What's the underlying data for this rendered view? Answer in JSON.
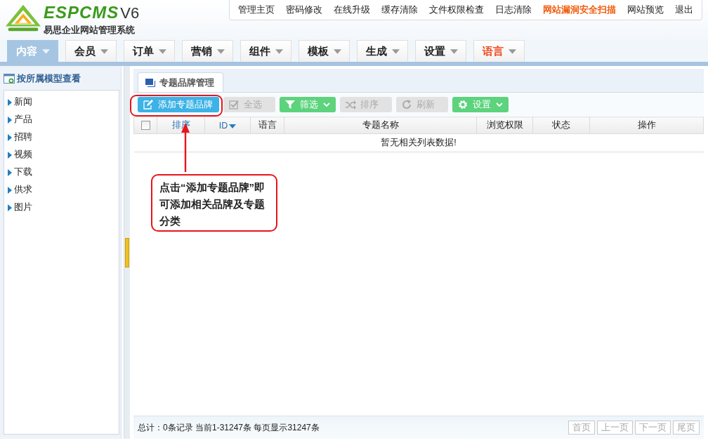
{
  "logo": {
    "brand": "ESPCMS",
    "version": "V6",
    "subtitle": "易思企业网站管理系统"
  },
  "top_links": [
    {
      "label": "管理主页",
      "highlight": false
    },
    {
      "label": "密码修改",
      "highlight": false
    },
    {
      "label": "在线升级",
      "highlight": false
    },
    {
      "label": "缓存清除",
      "highlight": false
    },
    {
      "label": "文件权限检查",
      "highlight": false
    },
    {
      "label": "日志清除",
      "highlight": false
    },
    {
      "label": "网站漏洞安全扫描",
      "highlight": true
    },
    {
      "label": "网站预览",
      "highlight": false
    },
    {
      "label": "退出",
      "highlight": false
    }
  ],
  "nav_tabs": [
    {
      "label": "内容",
      "selected": true,
      "highlight": false
    },
    {
      "label": "会员",
      "selected": false,
      "highlight": false
    },
    {
      "label": "订单",
      "selected": false,
      "highlight": false
    },
    {
      "label": "营销",
      "selected": false,
      "highlight": false
    },
    {
      "label": "组件",
      "selected": false,
      "highlight": false
    },
    {
      "label": "模板",
      "selected": false,
      "highlight": false
    },
    {
      "label": "生成",
      "selected": false,
      "highlight": false
    },
    {
      "label": "设置",
      "selected": false,
      "highlight": false
    },
    {
      "label": "语言",
      "selected": false,
      "highlight": true
    }
  ],
  "sidebar": {
    "title": "按所属模型查看",
    "items": [
      "新闻",
      "产品",
      "招聘",
      "视频",
      "下载",
      "供求",
      "图片"
    ]
  },
  "panel_tab": {
    "label": "专题品牌管理",
    "selected": true
  },
  "toolbar": [
    {
      "label": "添加专题品牌",
      "kind": "primary",
      "caret": false
    },
    {
      "label": "全选",
      "kind": "muted",
      "caret": false
    },
    {
      "label": "筛选",
      "kind": "green",
      "caret": true
    },
    {
      "label": "排序",
      "kind": "muted",
      "caret": false
    },
    {
      "label": "刷新",
      "kind": "muted",
      "caret": false
    },
    {
      "label": "设置",
      "kind": "green",
      "caret": true
    }
  ],
  "table": {
    "select_all": {
      "checked": false
    },
    "columns": [
      {
        "label": "排序",
        "kind": "link"
      },
      {
        "label": "ID",
        "kind": "sort"
      },
      {
        "label": "语言",
        "kind": "plain"
      },
      {
        "label": "专题名称",
        "kind": "plain"
      },
      {
        "label": "浏览权限",
        "kind": "plain"
      },
      {
        "label": "状态",
        "kind": "plain"
      },
      {
        "label": "操作",
        "kind": "plain"
      }
    ],
    "empty_message": "暂无相关列表数据!"
  },
  "annotation": {
    "text": "点击“添加专题品牌”即可添加相关品牌及专题分类"
  },
  "status_bar": {
    "summary": "总计：0条记录 当前1-31247条 每页显示31247条",
    "pager": [
      "首页",
      "上一页",
      "下一页",
      "尾页"
    ]
  }
}
